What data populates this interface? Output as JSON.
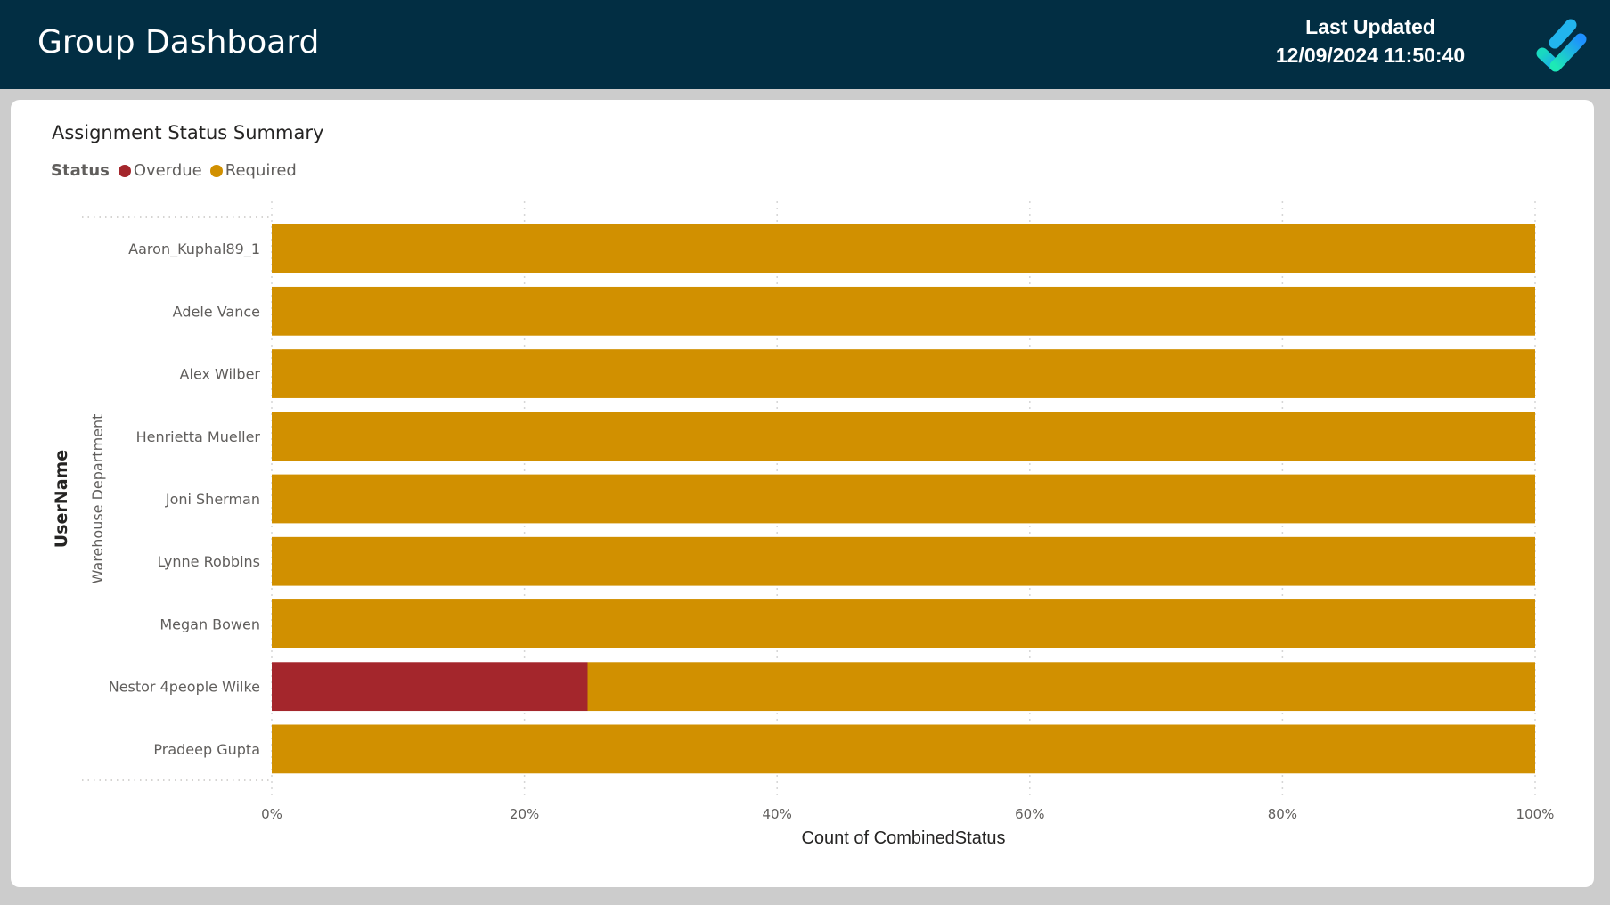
{
  "header": {
    "title": "Group Dashboard",
    "last_updated_label": "Last Updated",
    "last_updated_value": "12/09/2024 11:50:40",
    "logo_icon": "checkmark-logo-icon"
  },
  "colors": {
    "header_bg": "#022e43",
    "overdue": "#a4262c",
    "required": "#d19000"
  },
  "chart_data": {
    "type": "bar",
    "orientation": "horizontal",
    "stacked": "100%",
    "title": "Assignment Status Summary",
    "legend": {
      "title": "Status",
      "placement": "top-left",
      "entries": [
        {
          "name": "Overdue",
          "color": "#a4262c"
        },
        {
          "name": "Required",
          "color": "#d19000"
        }
      ]
    },
    "ylabel": "UserName",
    "ylabel_group": "Warehouse Department",
    "xlabel": "Count of CombinedStatus",
    "xlim": [
      0,
      100
    ],
    "xticks": [
      "0%",
      "20%",
      "40%",
      "60%",
      "80%",
      "100%"
    ],
    "xtick_values": [
      0,
      20,
      40,
      60,
      80,
      100
    ],
    "grid": true,
    "categories": [
      "Aaron_Kuphal89_1",
      "Adele Vance",
      "Alex Wilber",
      "Henrietta Mueller",
      "Joni Sherman",
      "Lynne Robbins",
      "Megan Bowen",
      "Nestor 4people Wilke",
      "Pradeep Gupta"
    ],
    "series": [
      {
        "name": "Overdue",
        "color": "#a4262c",
        "values": [
          0,
          0,
          0,
          0,
          0,
          0,
          0,
          25,
          0
        ]
      },
      {
        "name": "Required",
        "color": "#d19000",
        "values": [
          100,
          100,
          100,
          100,
          100,
          100,
          100,
          75,
          100
        ]
      }
    ]
  }
}
